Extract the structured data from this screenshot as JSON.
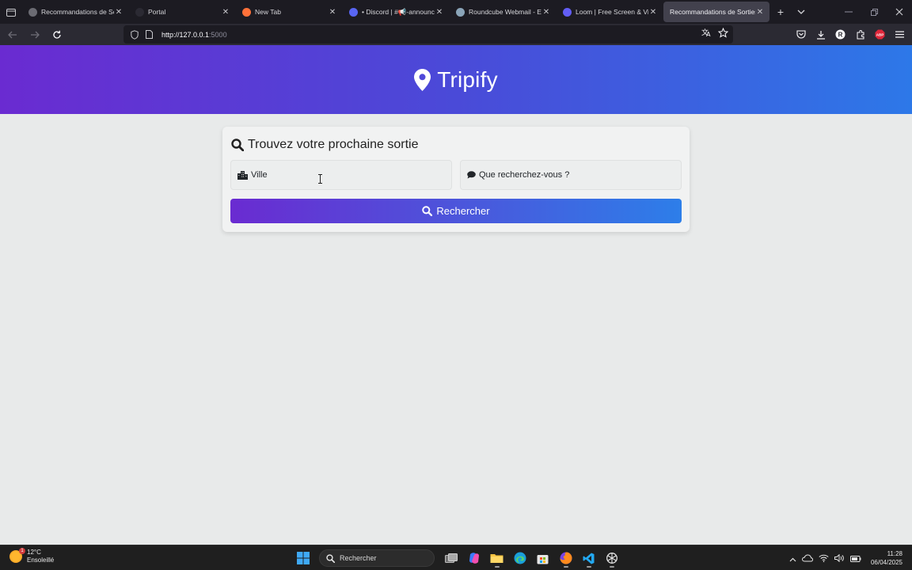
{
  "browser": {
    "tabs": [
      {
        "title": "Recommandations de Sorties",
        "favicon_color": "#6b6b73",
        "active": false
      },
      {
        "title": "Portal",
        "favicon_color": "#2b2a33",
        "active": false
      },
      {
        "title": "New Tab",
        "favicon_color": "#ff7139",
        "active": false
      },
      {
        "title": "• Discord | #📢-announceme",
        "favicon_color": "#5865f2",
        "active": false
      },
      {
        "title": "Roundcube Webmail - ENS",
        "favicon_color": "#8aa4b8",
        "active": false
      },
      {
        "title": "Loom | Free Screen & Video",
        "favicon_color": "#625df5",
        "active": false
      },
      {
        "title": "Recommandations de Sorties",
        "favicon_color": "#42414d",
        "active": true
      }
    ],
    "url_host": "http://127.0.0.1",
    "url_port": ":5000"
  },
  "page": {
    "brand": "Tripify",
    "card_title": "Trouvez votre prochaine sortie",
    "city_placeholder": "Ville",
    "query_placeholder": "Que recherchez-vous ?",
    "search_button": "Rechercher"
  },
  "taskbar": {
    "weather_temp": "12°C",
    "weather_desc": "Ensoleillé",
    "weather_badge": "1",
    "search_label": "Rechercher",
    "time": "11:28",
    "date": "06/04/2025"
  },
  "colors": {
    "gradient_start": "#6a2bd1",
    "gradient_end": "#2d78e8",
    "page_bg": "#e8eaea"
  }
}
